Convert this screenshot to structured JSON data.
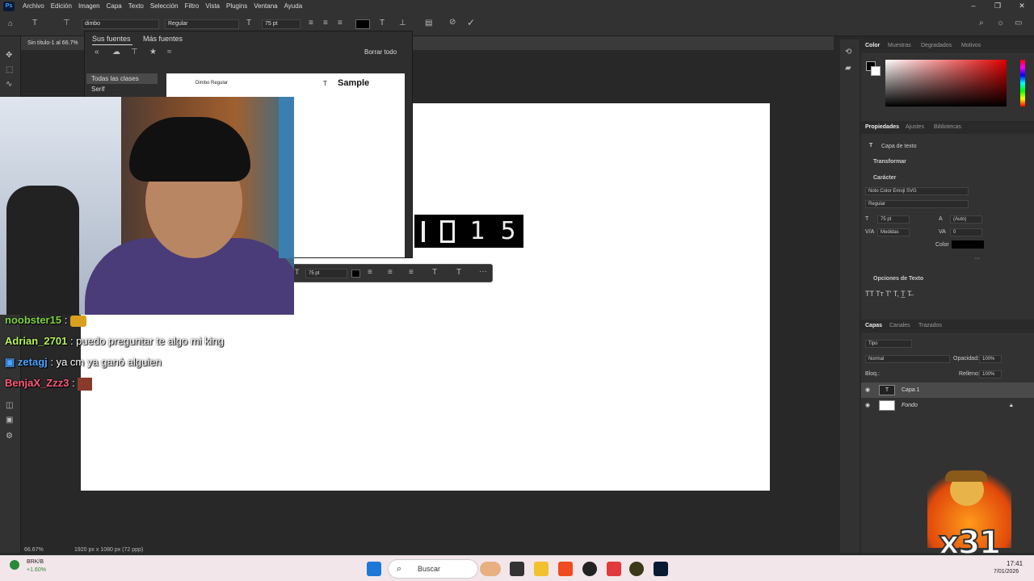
{
  "menubar": {
    "items": [
      "Archivo",
      "Edición",
      "Imagen",
      "Capa",
      "Texto",
      "Selección",
      "Filtro",
      "Vista",
      "Plugins",
      "Ventana",
      "Ayuda"
    ]
  },
  "options": {
    "font_name": "dimbo",
    "font_style": "Regular",
    "font_size": "75 pt"
  },
  "doc_tab": "Sin título-1 al 66.7%",
  "font_panel": {
    "tab_active": "Sus fuentes",
    "tab_other": "Más fuentes",
    "clear_all": "Borrar todo",
    "classes": [
      "Todas las clases",
      "Serif"
    ],
    "font_entry": "Dimbo Regular",
    "sample": "Sample"
  },
  "canvas_text": [
    "1",
    "5"
  ],
  "floatbar": {
    "size": "75 pt"
  },
  "chat": [
    {
      "user": "noobster15",
      "color": "#7fd43a",
      "text": ""
    },
    {
      "user": "Adrian_2701",
      "color": "#b6f25a",
      "text": "puedo preguntar te algo mi king"
    },
    {
      "user": "zetagj",
      "color": "#4aa3ff",
      "text": "ya cm ya ganó alguien"
    },
    {
      "user": "BenjaX_Zzz3",
      "color": "#ff5a7a",
      "text": ""
    }
  ],
  "right": {
    "color_tabs": [
      "Color",
      "Muestras",
      "Degradados",
      "Motivos"
    ],
    "prop_tabs": [
      "Propiedades",
      "Ajustes",
      "Bibliotecas"
    ],
    "layer_type": "Capa de texto",
    "transform": "Transformar",
    "character": "Carácter",
    "font": "Noto Color Emoji SVG",
    "style": "Regular",
    "size": "75 pt",
    "leading": "(Auto)",
    "kerning": "Medidas",
    "tracking": "0",
    "color_label": "Color",
    "text_options": "Opciones de Texto",
    "layer_tabs": [
      "Capas",
      "Canales",
      "Trazados"
    ],
    "search_placeholder": "Tipo",
    "blend": "Normal",
    "opacity_label": "Opacidad:",
    "opacity": "100%",
    "lock_label": "Bloq.:",
    "fill_label": "Relleno:",
    "fill": "100%",
    "layers": [
      "Capa 1",
      "Fondo"
    ]
  },
  "status": {
    "zoom": "66.67%",
    "doc": "1920 px x 1080 px (72 ppp)"
  },
  "taskbar": {
    "stock": "BRK/B",
    "change": "+1.60%",
    "search": "Buscar",
    "time": "17:41",
    "date": "7/01/2026"
  },
  "overlay": {
    "counter": "x31"
  },
  "colors": {
    "accent": "#31a8ff",
    "panel": "#323232",
    "bg": "#282828"
  }
}
